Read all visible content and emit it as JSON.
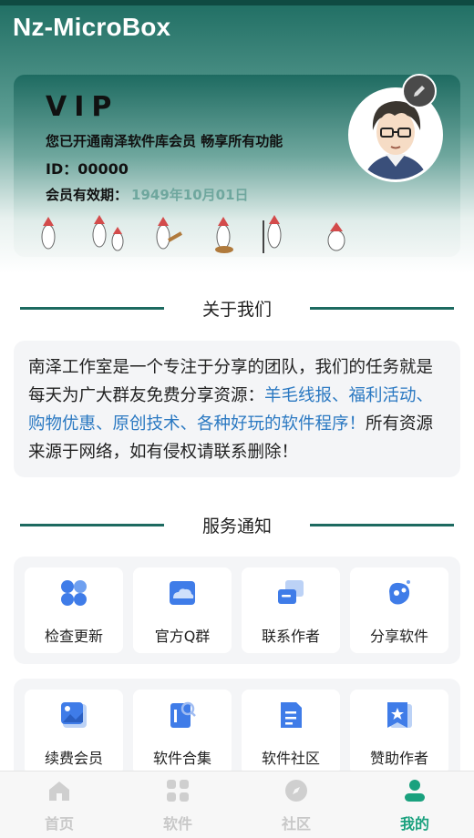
{
  "app": {
    "title": "Nz-MicroBox"
  },
  "vip": {
    "title": "VIP",
    "subtitle": "您已开通南泽软件库会员 畅享所有功能",
    "id_label": "ID：00000",
    "expiry_label": "会员有效期：",
    "expiry_date": "1949年10月01日"
  },
  "about": {
    "heading": "关于我们",
    "text_1": "南泽工作室是一个专注于分享的团队，我们的任务就是每天为广大群友免费分享资源：",
    "highlight": "羊毛线报、福利活动、购物优惠、原创技术、各种好玩的软件程序！",
    "text_2": "所有资源来源于网络，如有侵权请联系删除！"
  },
  "services": {
    "heading": "服务通知",
    "row1": [
      {
        "label": "检查更新",
        "icon": "apps-icon"
      },
      {
        "label": "官方Q群",
        "icon": "cloud-image-icon"
      },
      {
        "label": "联系作者",
        "icon": "chat-icon"
      },
      {
        "label": "分享软件",
        "icon": "share-icon"
      }
    ],
    "row2": [
      {
        "label": "续费会员",
        "icon": "picture-icon"
      },
      {
        "label": "软件合集",
        "icon": "search-doc-icon"
      },
      {
        "label": "软件社区",
        "icon": "document-icon"
      },
      {
        "label": "赞助作者",
        "icon": "star-bookmark-icon"
      }
    ]
  },
  "tabs": [
    {
      "label": "首页",
      "icon": "home-icon",
      "active": false
    },
    {
      "label": "软件",
      "icon": "grid-icon",
      "active": false
    },
    {
      "label": "社区",
      "icon": "compass-icon",
      "active": false
    },
    {
      "label": "我的",
      "icon": "user-icon",
      "active": true
    }
  ],
  "colors": {
    "accent": "#1d6a60",
    "active_tab": "#1aa17e",
    "icon_blue": "#3f7ce8",
    "link_blue": "#2b79c2"
  }
}
